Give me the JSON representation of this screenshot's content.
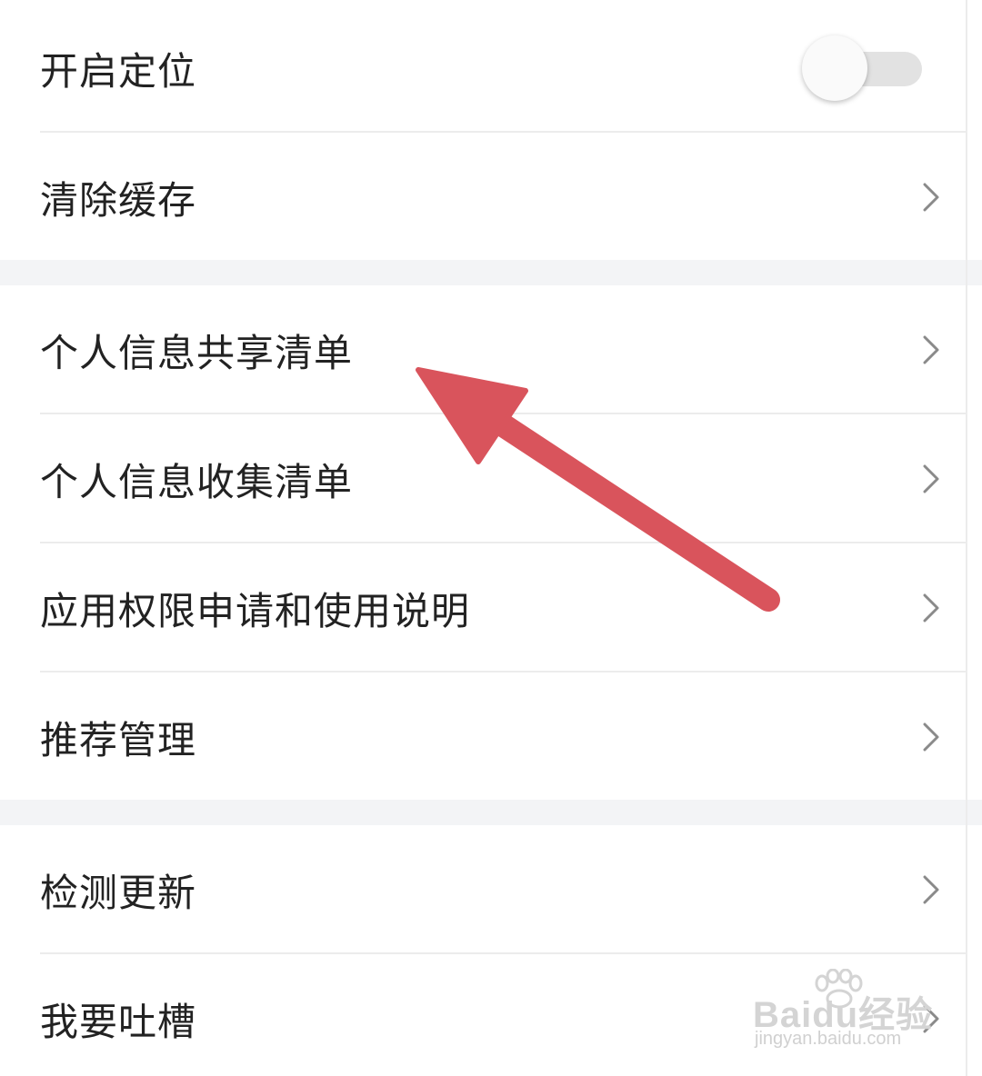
{
  "settings": {
    "group1": [
      {
        "label": "开启定位",
        "control": "toggle",
        "toggle_on": false
      },
      {
        "label": "清除缓存",
        "control": "chevron"
      }
    ],
    "group2": [
      {
        "label": "个人信息共享清单",
        "control": "chevron"
      },
      {
        "label": "个人信息收集清单",
        "control": "chevron"
      },
      {
        "label": "应用权限申请和使用说明",
        "control": "chevron"
      },
      {
        "label": "推荐管理",
        "control": "chevron"
      }
    ],
    "group3": [
      {
        "label": "检测更新",
        "control": "chevron"
      },
      {
        "label": "我要吐槽",
        "control": "chevron"
      }
    ]
  },
  "icons": {
    "chevron": "chevron-right-icon",
    "annotation": "red-arrow-annotation",
    "watermark_paw": "paw-icon"
  },
  "watermark": {
    "brand": "Baidu经验",
    "url": "jingyan.baidu.com"
  },
  "colors": {
    "background": "#ffffff",
    "section_gap": "#f3f4f6",
    "text": "#222222",
    "chevron": "#8a8a8a",
    "arrow": "#d9545c",
    "toggle_track": "#e2e2e2"
  }
}
